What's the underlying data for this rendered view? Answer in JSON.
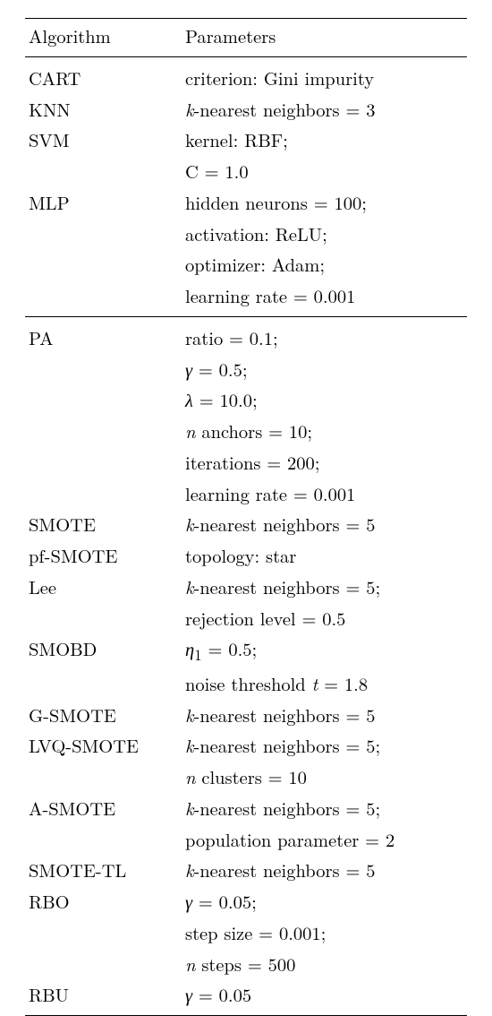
{
  "headers": {
    "algorithm": "Algorithm",
    "parameters": "Parameters"
  },
  "rows": [
    {
      "alg": "CART",
      "param": "criterion: Gini impurity",
      "cls": "section-start"
    },
    {
      "alg": "KNN",
      "param": "",
      "prefix_it": "k",
      "suffix": "-nearest neighbors = 3"
    },
    {
      "alg": "SVM",
      "param": "kernel: RBF;"
    },
    {
      "alg": "",
      "param": "C = 1.0"
    },
    {
      "alg": "MLP",
      "param": "hidden neurons = 100;"
    },
    {
      "alg": "",
      "param": "activation: ReLU;"
    },
    {
      "alg": "",
      "param": "optimizer: Adam;"
    },
    {
      "alg": "",
      "param": "learning rate = 0.001",
      "cls": "group-end"
    },
    {
      "alg": "PA",
      "param": "ratio = 0.1;",
      "cls": "section-start"
    },
    {
      "alg": "",
      "param": "",
      "prefix_it": "γ",
      "suffix": " = 0.5;"
    },
    {
      "alg": "",
      "param": "",
      "prefix_it": "λ",
      "suffix": " = 10.0;"
    },
    {
      "alg": "",
      "param": "",
      "prefix_it": "n",
      "suffix": " anchors = 10;"
    },
    {
      "alg": "",
      "param": "iterations = 200;"
    },
    {
      "alg": "",
      "param": "learning rate = 0.001"
    },
    {
      "alg": "SMOTE",
      "param": "",
      "prefix_it": "k",
      "suffix": "-nearest neighbors = 5"
    },
    {
      "alg": "pf-SMOTE",
      "param": "topology: star"
    },
    {
      "alg": "Lee",
      "param": "",
      "prefix_it": "k",
      "suffix": "-nearest neighbors = 5;"
    },
    {
      "alg": "",
      "param": "rejection level = 0.5"
    },
    {
      "alg": "SMOBD",
      "param": "",
      "prefix_it": "η",
      "sub": "1",
      "suffix": " = 0.5;"
    },
    {
      "alg": "",
      "param": "",
      "pre_text": "noise threshold ",
      "prefix_it": "t",
      "suffix": " = 1.8"
    },
    {
      "alg": "G-SMOTE",
      "param": "",
      "prefix_it": "k",
      "suffix": "-nearest neighbors = 5"
    },
    {
      "alg": "LVQ-SMOTE",
      "param": "",
      "prefix_it": "k",
      "suffix": "-nearest neighbors = 5;"
    },
    {
      "alg": "",
      "param": "",
      "prefix_it": "n",
      "suffix": " clusters = 10"
    },
    {
      "alg": "A-SMOTE",
      "param": "",
      "prefix_it": "k",
      "suffix": "-nearest neighbors = 5;"
    },
    {
      "alg": "",
      "param": "population parameter = 2"
    },
    {
      "alg": "SMOTE-TL",
      "param": "",
      "prefix_it": "k",
      "suffix": "-nearest neighbors = 5"
    },
    {
      "alg": "RBO",
      "param": "",
      "prefix_it": "γ",
      "suffix": " = 0.05;"
    },
    {
      "alg": "",
      "param": "step size = 0.001;"
    },
    {
      "alg": "",
      "param": "",
      "prefix_it": "n",
      "suffix": " steps = 500"
    },
    {
      "alg": "RBU",
      "param": "",
      "prefix_it": "γ",
      "suffix": " = 0.05",
      "cls": "last"
    }
  ]
}
